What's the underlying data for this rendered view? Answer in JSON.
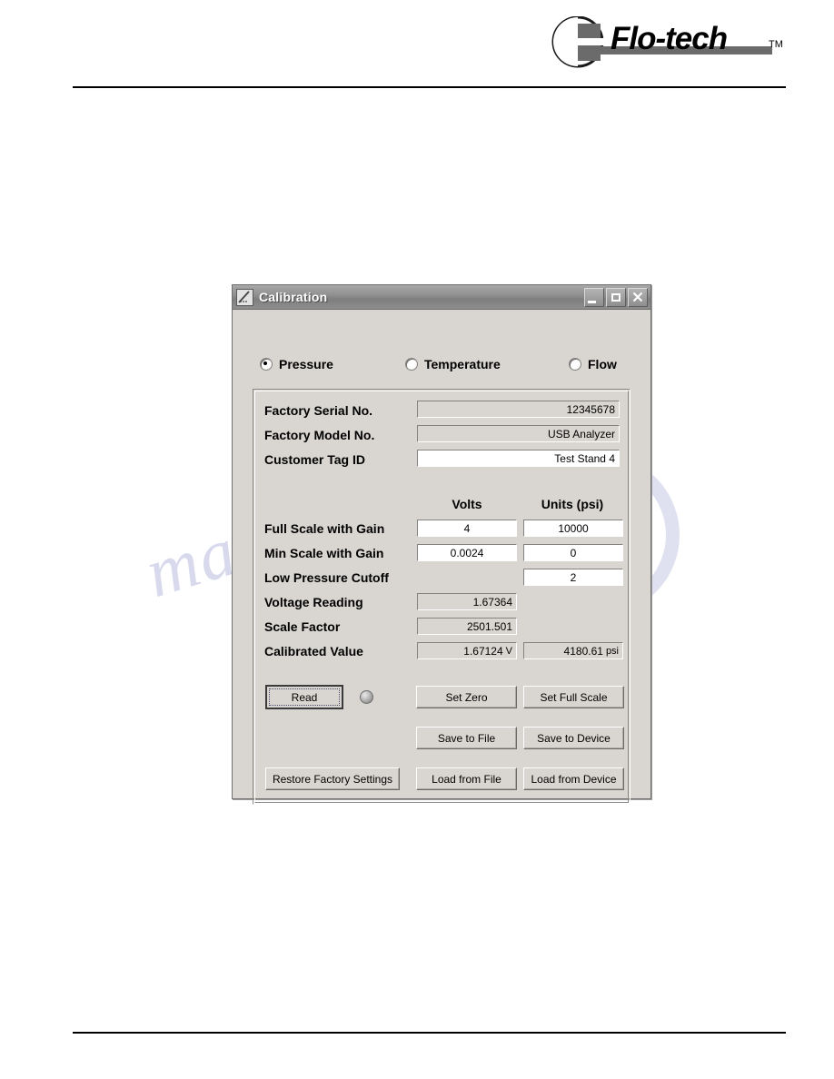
{
  "page": {
    "brand": {
      "name": "Flo-tech",
      "trademark": "TM",
      "logo_icon": "flo-tech-logo"
    },
    "watermark": "manualshive.com"
  },
  "window": {
    "title": "Calibration",
    "icon": "calibration-chart-icon",
    "controls": {
      "minimize": "Minimize",
      "maximize": "Maximize",
      "close": "Close"
    },
    "title_bar_color": "#8e8e8e",
    "client_color": "#d9d6d1"
  },
  "mode_radios": [
    {
      "label": "Pressure",
      "checked": true
    },
    {
      "label": "Temperature",
      "checked": false
    },
    {
      "label": "Flow",
      "checked": false
    }
  ],
  "identity_fields": [
    {
      "label": "Factory Serial No.",
      "value": "12345678",
      "editable": false
    },
    {
      "label": "Factory Model No.",
      "value": "USB Analyzer",
      "editable": false
    },
    {
      "label": "Customer Tag ID",
      "value": "Test Stand 4",
      "editable": true
    }
  ],
  "columns": {
    "volts": "Volts",
    "units": "Units (psi)"
  },
  "scale_rows": [
    {
      "label": "Full Scale with Gain",
      "volts": "4",
      "units": "10000"
    },
    {
      "label": "Min Scale with Gain",
      "volts": "0.0024",
      "units": "0"
    },
    {
      "label": "Low Pressure Cutoff",
      "volts": "",
      "units": "2"
    }
  ],
  "readout_rows": [
    {
      "label": "Voltage Reading",
      "value": "1.67364",
      "unit": ""
    },
    {
      "label": "Scale Factor",
      "value": "2501.501",
      "unit": ""
    },
    {
      "label": "Calibrated Value",
      "value": "1.67124",
      "unit": "V",
      "value2": "4180.61",
      "unit2": "psi"
    }
  ],
  "buttons": {
    "read": "Read",
    "set_zero": "Set Zero",
    "set_full_scale": "Set Full Scale",
    "save_to_file": "Save to File",
    "save_to_device": "Save to Device",
    "restore_factory_settings": "Restore Factory Settings",
    "load_from_file": "Load from File",
    "load_from_device": "Load from Device"
  },
  "indicator": {
    "name": "read-status-led",
    "color": "#9a9a9a"
  }
}
